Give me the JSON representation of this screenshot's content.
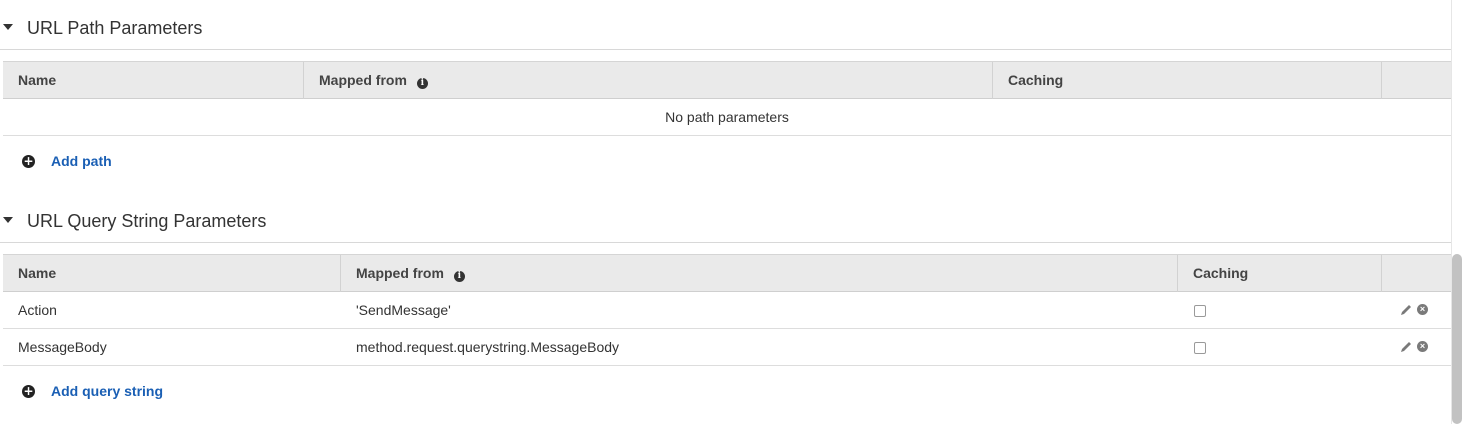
{
  "path_section": {
    "title": "URL Path Parameters",
    "columns": {
      "name": "Name",
      "mapped_from": "Mapped from",
      "caching": "Caching"
    },
    "empty_message": "No path parameters",
    "add_label": "Add path"
  },
  "query_section": {
    "title": "URL Query String Parameters",
    "columns": {
      "name": "Name",
      "mapped_from": "Mapped from",
      "caching": "Caching"
    },
    "rows": [
      {
        "name": "Action",
        "mapped_from": "'SendMessage'",
        "caching": false
      },
      {
        "name": "MessageBody",
        "mapped_from": "method.request.querystring.MessageBody",
        "caching": false
      }
    ],
    "add_label": "Add query string"
  },
  "icons": {
    "collapse": "caret-down-icon",
    "info": "info-icon",
    "add": "plus-circle-icon",
    "edit": "pencil-icon",
    "remove": "remove-circle-icon"
  },
  "colors": {
    "link": "#1a5fb4",
    "header_bg": "#eaeaea"
  }
}
